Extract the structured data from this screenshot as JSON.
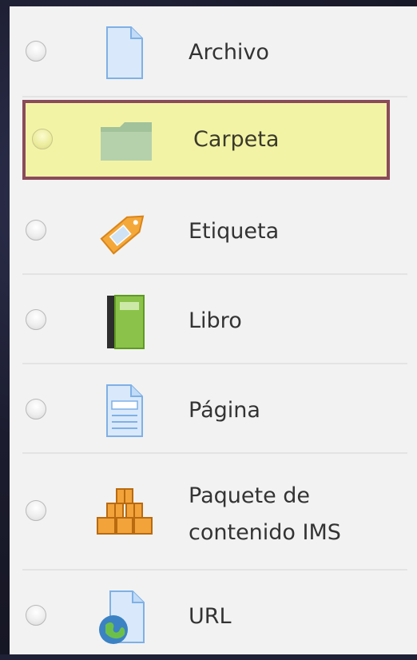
{
  "activities": [
    {
      "label": "Archivo",
      "icon": "file-icon"
    },
    {
      "label": "Carpeta",
      "icon": "folder-icon"
    },
    {
      "label": "Etiqueta",
      "icon": "tag-icon"
    },
    {
      "label": "Libro",
      "icon": "book-icon"
    },
    {
      "label": "Página",
      "icon": "page-icon"
    },
    {
      "label": "Paquete de contenido IMS",
      "icon": "package-icon"
    },
    {
      "label": "URL",
      "icon": "url-icon"
    }
  ],
  "colors": {
    "highlight_fill": "#f3f3a6",
    "highlight_border": "#8a4b5a",
    "panel": "#f2f2f2",
    "text": "#333333"
  }
}
